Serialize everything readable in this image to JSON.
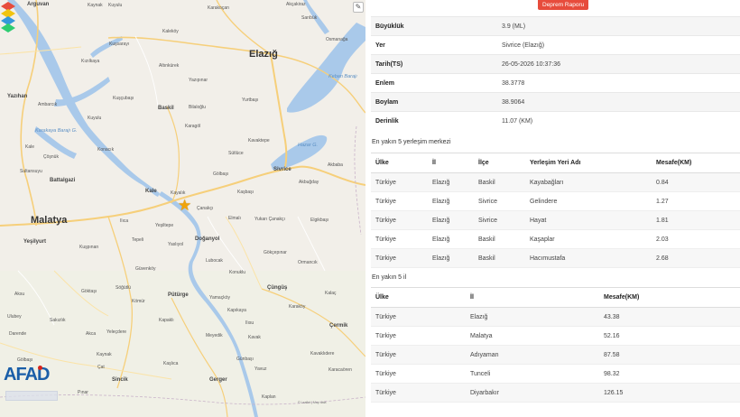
{
  "map": {
    "layers_button": "✎",
    "logo_text": "AFAD",
    "attribution": "© Leaflet | Map data",
    "cities": [
      {
        "name": "Elazığ",
        "cls": "city",
        "l": 276,
        "t": 54
      },
      {
        "name": "Malatya",
        "cls": "city",
        "l": 34,
        "t": 238
      },
      {
        "name": "Sivrice",
        "cls": "town",
        "l": 303,
        "t": 185
      },
      {
        "name": "Baskil",
        "cls": "town",
        "l": 175,
        "t": 117
      },
      {
        "name": "Kale",
        "cls": "town",
        "l": 161,
        "t": 209
      },
      {
        "name": "Doğanyol",
        "cls": "town",
        "l": 216,
        "t": 262
      },
      {
        "name": "Pütürge",
        "cls": "town",
        "l": 186,
        "t": 324
      },
      {
        "name": "Battalgazi",
        "cls": "town",
        "l": 55,
        "t": 197
      },
      {
        "name": "Yeşilyurt",
        "cls": "town",
        "l": 26,
        "t": 265
      },
      {
        "name": "Yazıhan",
        "cls": "town",
        "l": 8,
        "t": 104
      },
      {
        "name": "Çüngüş",
        "cls": "town",
        "l": 296,
        "t": 316
      },
      {
        "name": "Çermik",
        "cls": "town",
        "l": 365,
        "t": 358
      },
      {
        "name": "Gerger",
        "cls": "town",
        "l": 232,
        "t": 418
      },
      {
        "name": "Sincik",
        "cls": "town",
        "l": 124,
        "t": 418
      },
      {
        "name": "Arguvan",
        "cls": "town",
        "l": 30,
        "t": 2
      }
    ],
    "villages": [
      {
        "name": "Kaynak",
        "l": 97,
        "t": 3
      },
      {
        "name": "Kuyulu",
        "l": 120,
        "t": 3
      },
      {
        "name": "Akçakiraz",
        "l": 317,
        "t": 2
      },
      {
        "name": "Sarıbük",
        "l": 334,
        "t": 17
      },
      {
        "name": "Osmanağa",
        "l": 361,
        "t": 41
      },
      {
        "name": "Keban Barajı",
        "l": 364,
        "t": 82
      },
      {
        "name": "Yurtbaşı",
        "l": 268,
        "t": 108
      },
      {
        "name": "Yazıpınar",
        "l": 209,
        "t": 86
      },
      {
        "name": "Karakoçan",
        "l": 230,
        "t": 6
      },
      {
        "name": "Kaleköy",
        "l": 180,
        "t": 32
      },
      {
        "name": "Altınkürek",
        "l": 176,
        "t": 70
      },
      {
        "name": "Kuşsarayı",
        "l": 121,
        "t": 46
      },
      {
        "name": "Kızılkaya",
        "l": 90,
        "t": 65
      },
      {
        "name": "Ambarcık",
        "l": 42,
        "t": 113
      },
      {
        "name": "Kuyulu",
        "l": 97,
        "t": 128
      },
      {
        "name": "Kuşçubaşı",
        "l": 125,
        "t": 106
      },
      {
        "name": "Karakaya Barajı G.",
        "l": 39,
        "t": 142
      },
      {
        "name": "Hazar G.",
        "l": 330,
        "t": 158
      },
      {
        "name": "Kavaktepe",
        "l": 275,
        "t": 153
      },
      {
        "name": "Karagöl",
        "l": 205,
        "t": 137
      },
      {
        "name": "Bilaloğlu",
        "l": 209,
        "t": 116
      },
      {
        "name": "Sütlüce",
        "l": 253,
        "t": 167
      },
      {
        "name": "Konacık",
        "l": 108,
        "t": 163
      },
      {
        "name": "Sultansuyu",
        "l": 22,
        "t": 187
      },
      {
        "name": "Çöşnük",
        "l": 48,
        "t": 171
      },
      {
        "name": "Kale",
        "l": 28,
        "t": 160
      },
      {
        "name": "Akbaba",
        "l": 363,
        "t": 180
      },
      {
        "name": "Akbuğday",
        "l": 331,
        "t": 199
      },
      {
        "name": "Kaşbaşı",
        "l": 263,
        "t": 210
      },
      {
        "name": "Gölbaşı",
        "l": 236,
        "t": 190
      },
      {
        "name": "Kayalık",
        "l": 189,
        "t": 211
      },
      {
        "name": "Çanakçı",
        "l": 218,
        "t": 228
      },
      {
        "name": "Elmalı",
        "l": 253,
        "t": 239
      },
      {
        "name": "Yukarı Çanakçı",
        "l": 282,
        "t": 240
      },
      {
        "name": "Elgikbaşı",
        "l": 344,
        "t": 241
      },
      {
        "name": "Ilıca",
        "l": 133,
        "t": 242
      },
      {
        "name": "Kuşpınarı",
        "l": 88,
        "t": 271
      },
      {
        "name": "Yeşiltepe",
        "l": 172,
        "t": 247
      },
      {
        "name": "Yaslıyol",
        "l": 186,
        "t": 268
      },
      {
        "name": "Lubocak",
        "l": 228,
        "t": 286
      },
      {
        "name": "Konuklu",
        "l": 254,
        "t": 299
      },
      {
        "name": "Gökçepınar",
        "l": 292,
        "t": 277
      },
      {
        "name": "Ormancık",
        "l": 330,
        "t": 288
      },
      {
        "name": "Kalaç",
        "l": 360,
        "t": 322
      },
      {
        "name": "Tepeli",
        "l": 146,
        "t": 263
      },
      {
        "name": "Güvenköy",
        "l": 150,
        "t": 295
      },
      {
        "name": "Söğütlü",
        "l": 128,
        "t": 316
      },
      {
        "name": "Kömür",
        "l": 146,
        "t": 331
      },
      {
        "name": "Göktaşı",
        "l": 90,
        "t": 320
      },
      {
        "name": "Yamaçköy",
        "l": 232,
        "t": 327
      },
      {
        "name": "Kapıkaya",
        "l": 252,
        "t": 341
      },
      {
        "name": "Karaköy",
        "l": 320,
        "t": 337
      },
      {
        "name": "Ilısu",
        "l": 272,
        "t": 355
      },
      {
        "name": "Meyedik",
        "l": 228,
        "t": 369
      },
      {
        "name": "Kavak",
        "l": 275,
        "t": 371
      },
      {
        "name": "Kapaklı",
        "l": 176,
        "t": 352
      },
      {
        "name": "Yeleçdere",
        "l": 118,
        "t": 365
      },
      {
        "name": "Akca",
        "l": 95,
        "t": 367
      },
      {
        "name": "Sakızlık",
        "l": 55,
        "t": 352
      },
      {
        "name": "Ulubey",
        "l": 8,
        "t": 348
      },
      {
        "name": "Aksu",
        "l": 16,
        "t": 323
      },
      {
        "name": "Darende",
        "l": 10,
        "t": 367
      },
      {
        "name": "Gölbaşı",
        "l": 19,
        "t": 396
      },
      {
        "name": "Karacaören",
        "l": 364,
        "t": 407
      },
      {
        "name": "Kavaklıdere",
        "l": 344,
        "t": 389
      },
      {
        "name": "Günbaşı",
        "l": 262,
        "t": 395
      },
      {
        "name": "Yavuz",
        "l": 282,
        "t": 406
      },
      {
        "name": "Kaşlıca",
        "l": 181,
        "t": 400
      },
      {
        "name": "Çat",
        "l": 108,
        "t": 404
      },
      {
        "name": "Kaynak",
        "l": 107,
        "t": 390
      },
      {
        "name": "Pınar",
        "l": 86,
        "t": 432
      },
      {
        "name": "Kaplan",
        "l": 290,
        "t": 437
      }
    ]
  },
  "report_button": "Deprem Raporu",
  "details": [
    {
      "label": "Büyüklük",
      "value": "3.9 (ML)"
    },
    {
      "label": "Yer",
      "value": "Sivrice (Elazığ)"
    },
    {
      "label": "Tarih(TS)",
      "value": "26-05-2026 10:37:36"
    },
    {
      "label": "Enlem",
      "value": "38.3778"
    },
    {
      "label": "Boylam",
      "value": "38.9064"
    },
    {
      "label": "Derinlik",
      "value": "11.07 (KM)"
    }
  ],
  "settlements": {
    "title": "En yakın 5 yerleşim merkezi",
    "headers": [
      "Ülke",
      "İl",
      "İlçe",
      "Yerleşim Yeri Adı",
      "Mesafe(KM)"
    ],
    "rows": [
      [
        "Türkiye",
        "Elazığ",
        "Baskil",
        "Kayabağları",
        "0.84"
      ],
      [
        "Türkiye",
        "Elazığ",
        "Sivrice",
        "Gelindere",
        "1.27"
      ],
      [
        "Türkiye",
        "Elazığ",
        "Sivrice",
        "Hayat",
        "1.81"
      ],
      [
        "Türkiye",
        "Elazığ",
        "Baskil",
        "Kaşaplar",
        "2.03"
      ],
      [
        "Türkiye",
        "Elazığ",
        "Baskil",
        "Hacımustafa",
        "2.68"
      ]
    ]
  },
  "provinces": {
    "title": "En yakın 5 il",
    "headers": [
      "Ülke",
      "İl",
      "Mesafe(KM)"
    ],
    "rows": [
      [
        "Türkiye",
        "Elazığ",
        "43.38"
      ],
      [
        "Türkiye",
        "Malatya",
        "52.16"
      ],
      [
        "Türkiye",
        "Adıyaman",
        "87.58"
      ],
      [
        "Türkiye",
        "Tunceli",
        "98.32"
      ],
      [
        "Türkiye",
        "Diyarbakır",
        "126.15"
      ]
    ]
  }
}
